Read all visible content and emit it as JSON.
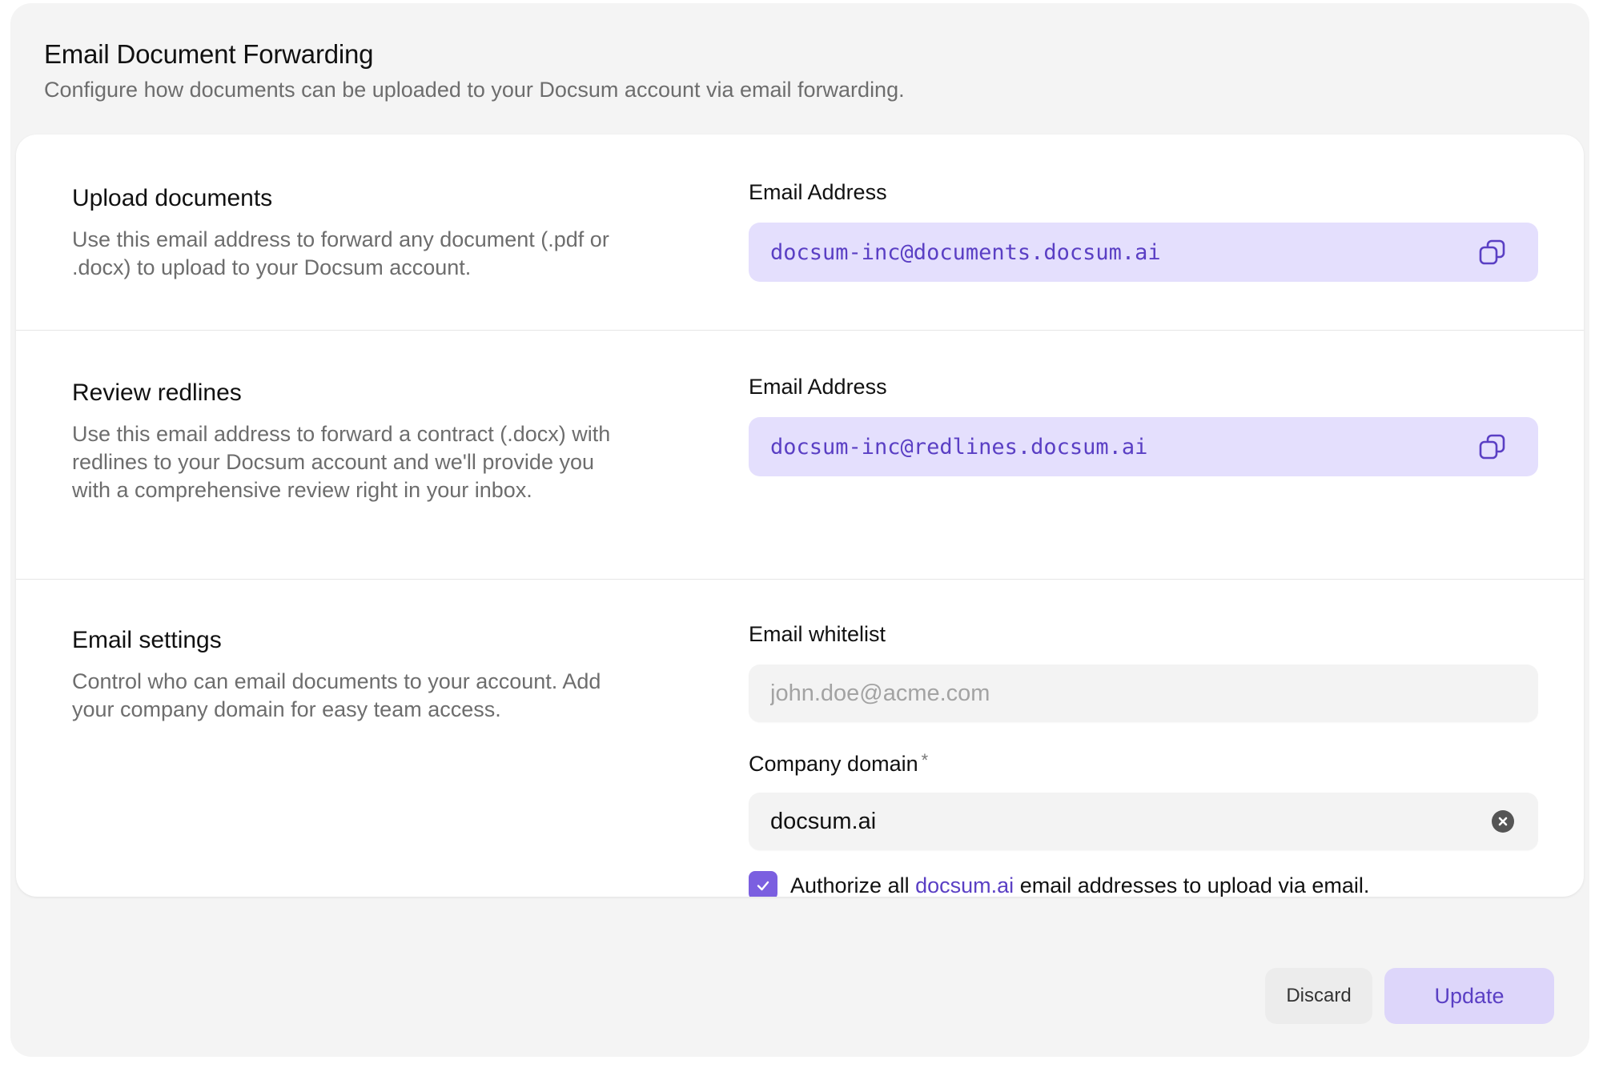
{
  "header": {
    "title": "Email Document Forwarding",
    "subtitle": "Configure how documents can be uploaded to your Docsum account via email forwarding."
  },
  "sections": {
    "upload": {
      "title": "Upload documents",
      "description": "Use this email address to forward any document (.pdf or .docx) to upload to your Docsum account.",
      "field_label": "Email Address",
      "email": "docsum-inc@documents.docsum.ai",
      "copy_icon": "copy-icon"
    },
    "redlines": {
      "title": "Review redlines",
      "description": "Use this email address to forward a contract (.docx) with redlines to your Docsum account and we'll provide you with a comprehensive review right in your inbox.",
      "field_label": "Email Address",
      "email": "docsum-inc@redlines.docsum.ai",
      "copy_icon": "copy-icon"
    },
    "settings": {
      "title": "Email settings",
      "description": "Control who can email documents to your account. Add your company domain for easy team access.",
      "whitelist_label": "Email whitelist",
      "whitelist_placeholder": "john.doe@acme.com",
      "whitelist_value": "",
      "domain_label": "Company domain",
      "required_marker": "*",
      "domain_value": "docsum.ai",
      "clear_icon": "clear-icon",
      "authorize": {
        "checked": true,
        "prefix": "Authorize all",
        "domain": "docsum.ai",
        "suffix": "email addresses to upload via email."
      }
    }
  },
  "footer": {
    "discard_label": "Discard",
    "update_label": "Update"
  },
  "colors": {
    "accent": "#7b5fe0",
    "accent_text": "#5a3fc4",
    "email_box_bg": "#e4dffd",
    "update_button_bg": "#ddd6fa",
    "page_bg": "#f4f4f4"
  }
}
